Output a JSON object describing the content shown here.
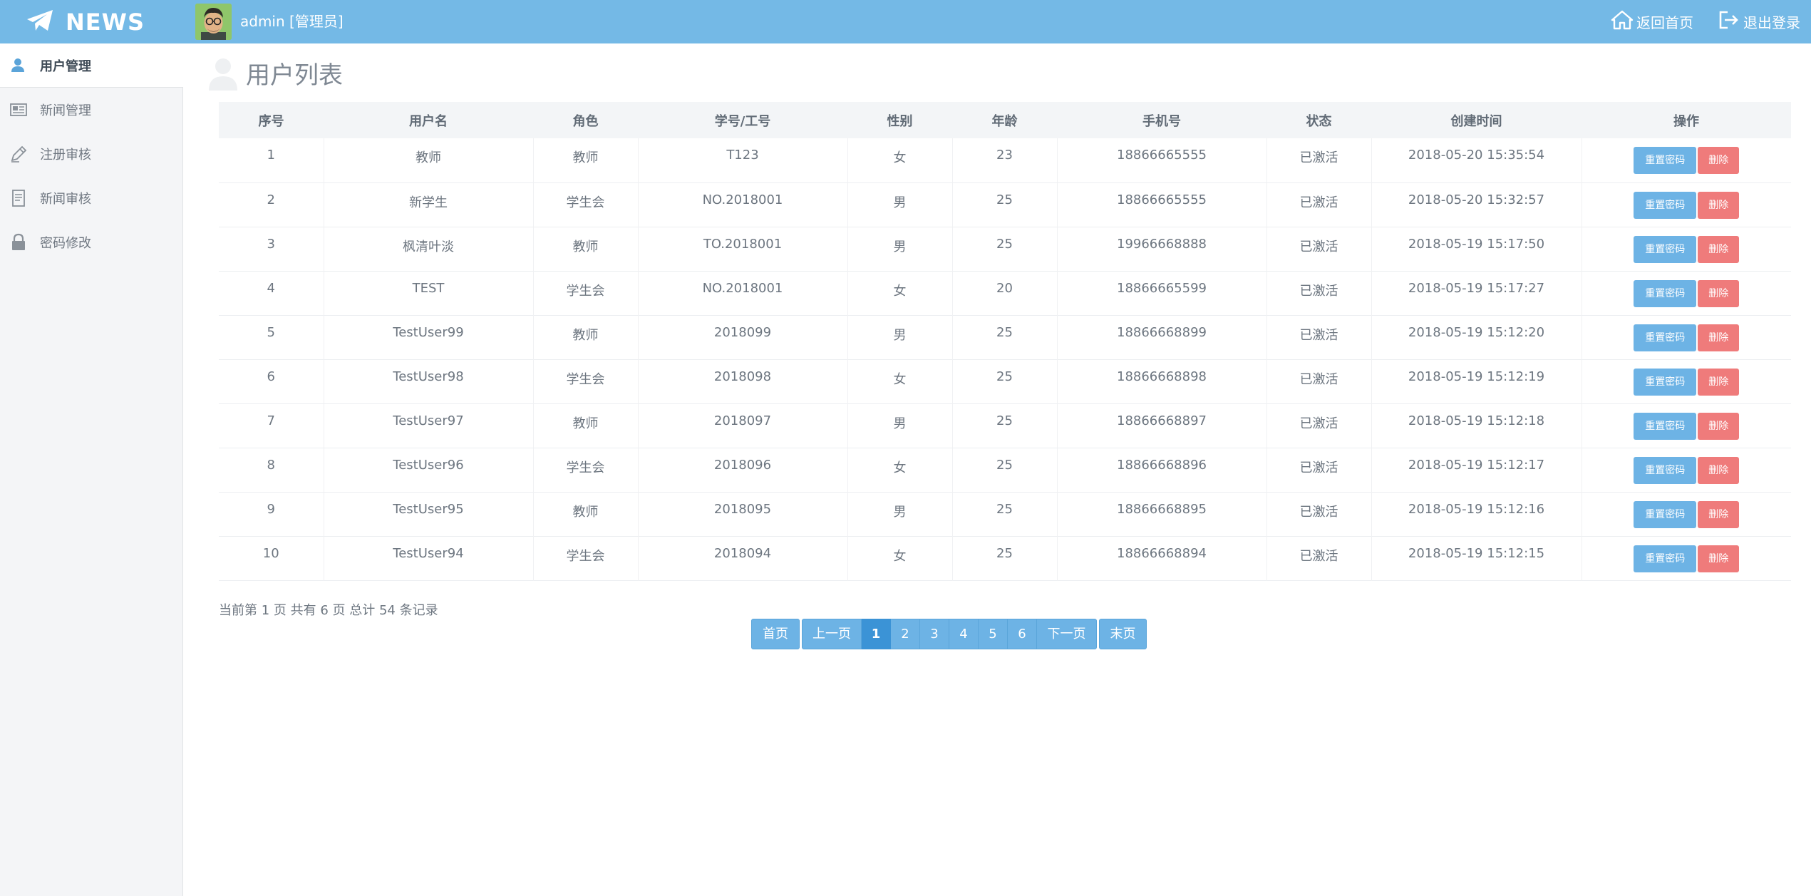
{
  "header": {
    "brand": "NEWS",
    "user": "admin [管理员]",
    "home_link": "返回首页",
    "logout_link": "退出登录"
  },
  "sidebar": {
    "items": [
      {
        "label": "用户管理",
        "icon": "user-icon",
        "active": true
      },
      {
        "label": "新闻管理",
        "icon": "newspaper-icon",
        "active": false
      },
      {
        "label": "注册审核",
        "icon": "pencil-icon",
        "active": false
      },
      {
        "label": "新闻审核",
        "icon": "document-icon",
        "active": false
      },
      {
        "label": "密码修改",
        "icon": "lock-icon",
        "active": false
      }
    ]
  },
  "main": {
    "title": "用户列表",
    "table": {
      "columns": [
        "序号",
        "用户名",
        "角色",
        "学号/工号",
        "性别",
        "年龄",
        "手机号",
        "状态",
        "创建时间",
        "操作"
      ],
      "rows": [
        [
          "1",
          "教师",
          "教师",
          "T123",
          "女",
          "23",
          "18866665555",
          "已激活",
          "2018-05-20 15:35:54"
        ],
        [
          "2",
          "新学生",
          "学生会",
          "NO.2018001",
          "男",
          "25",
          "18866665555",
          "已激活",
          "2018-05-20 15:32:57"
        ],
        [
          "3",
          "枫清叶淡",
          "教师",
          "TO.2018001",
          "男",
          "25",
          "19966668888",
          "已激活",
          "2018-05-19 15:17:50"
        ],
        [
          "4",
          "TEST",
          "学生会",
          "NO.2018001",
          "女",
          "20",
          "18866665599",
          "已激活",
          "2018-05-19 15:17:27"
        ],
        [
          "5",
          "TestUser99",
          "教师",
          "2018099",
          "男",
          "25",
          "18866668899",
          "已激活",
          "2018-05-19 15:12:20"
        ],
        [
          "6",
          "TestUser98",
          "学生会",
          "2018098",
          "女",
          "25",
          "18866668898",
          "已激活",
          "2018-05-19 15:12:19"
        ],
        [
          "7",
          "TestUser97",
          "教师",
          "2018097",
          "男",
          "25",
          "18866668897",
          "已激活",
          "2018-05-19 15:12:18"
        ],
        [
          "8",
          "TestUser96",
          "学生会",
          "2018096",
          "女",
          "25",
          "18866668896",
          "已激活",
          "2018-05-19 15:12:17"
        ],
        [
          "9",
          "TestUser95",
          "教师",
          "2018095",
          "男",
          "25",
          "18866668895",
          "已激活",
          "2018-05-19 15:12:16"
        ],
        [
          "10",
          "TestUser94",
          "学生会",
          "2018094",
          "女",
          "25",
          "18866668894",
          "已激活",
          "2018-05-19 15:12:15"
        ]
      ],
      "actions": {
        "reset": "重置密码",
        "delete": "删除"
      }
    },
    "record_info": "当前第 1 页 共有 6 页 总计 54 条记录",
    "pagination": {
      "first": "首页",
      "prev": "上一页",
      "pages": [
        "1",
        "2",
        "3",
        "4",
        "5",
        "6"
      ],
      "current": "1",
      "next": "下一页",
      "last": "末页"
    }
  },
  "colors": {
    "header_bg": "#74b9e6",
    "reset_button": "#6db3e5",
    "delete_button": "#ef7b7b",
    "pager_current": "#3b93d6"
  }
}
